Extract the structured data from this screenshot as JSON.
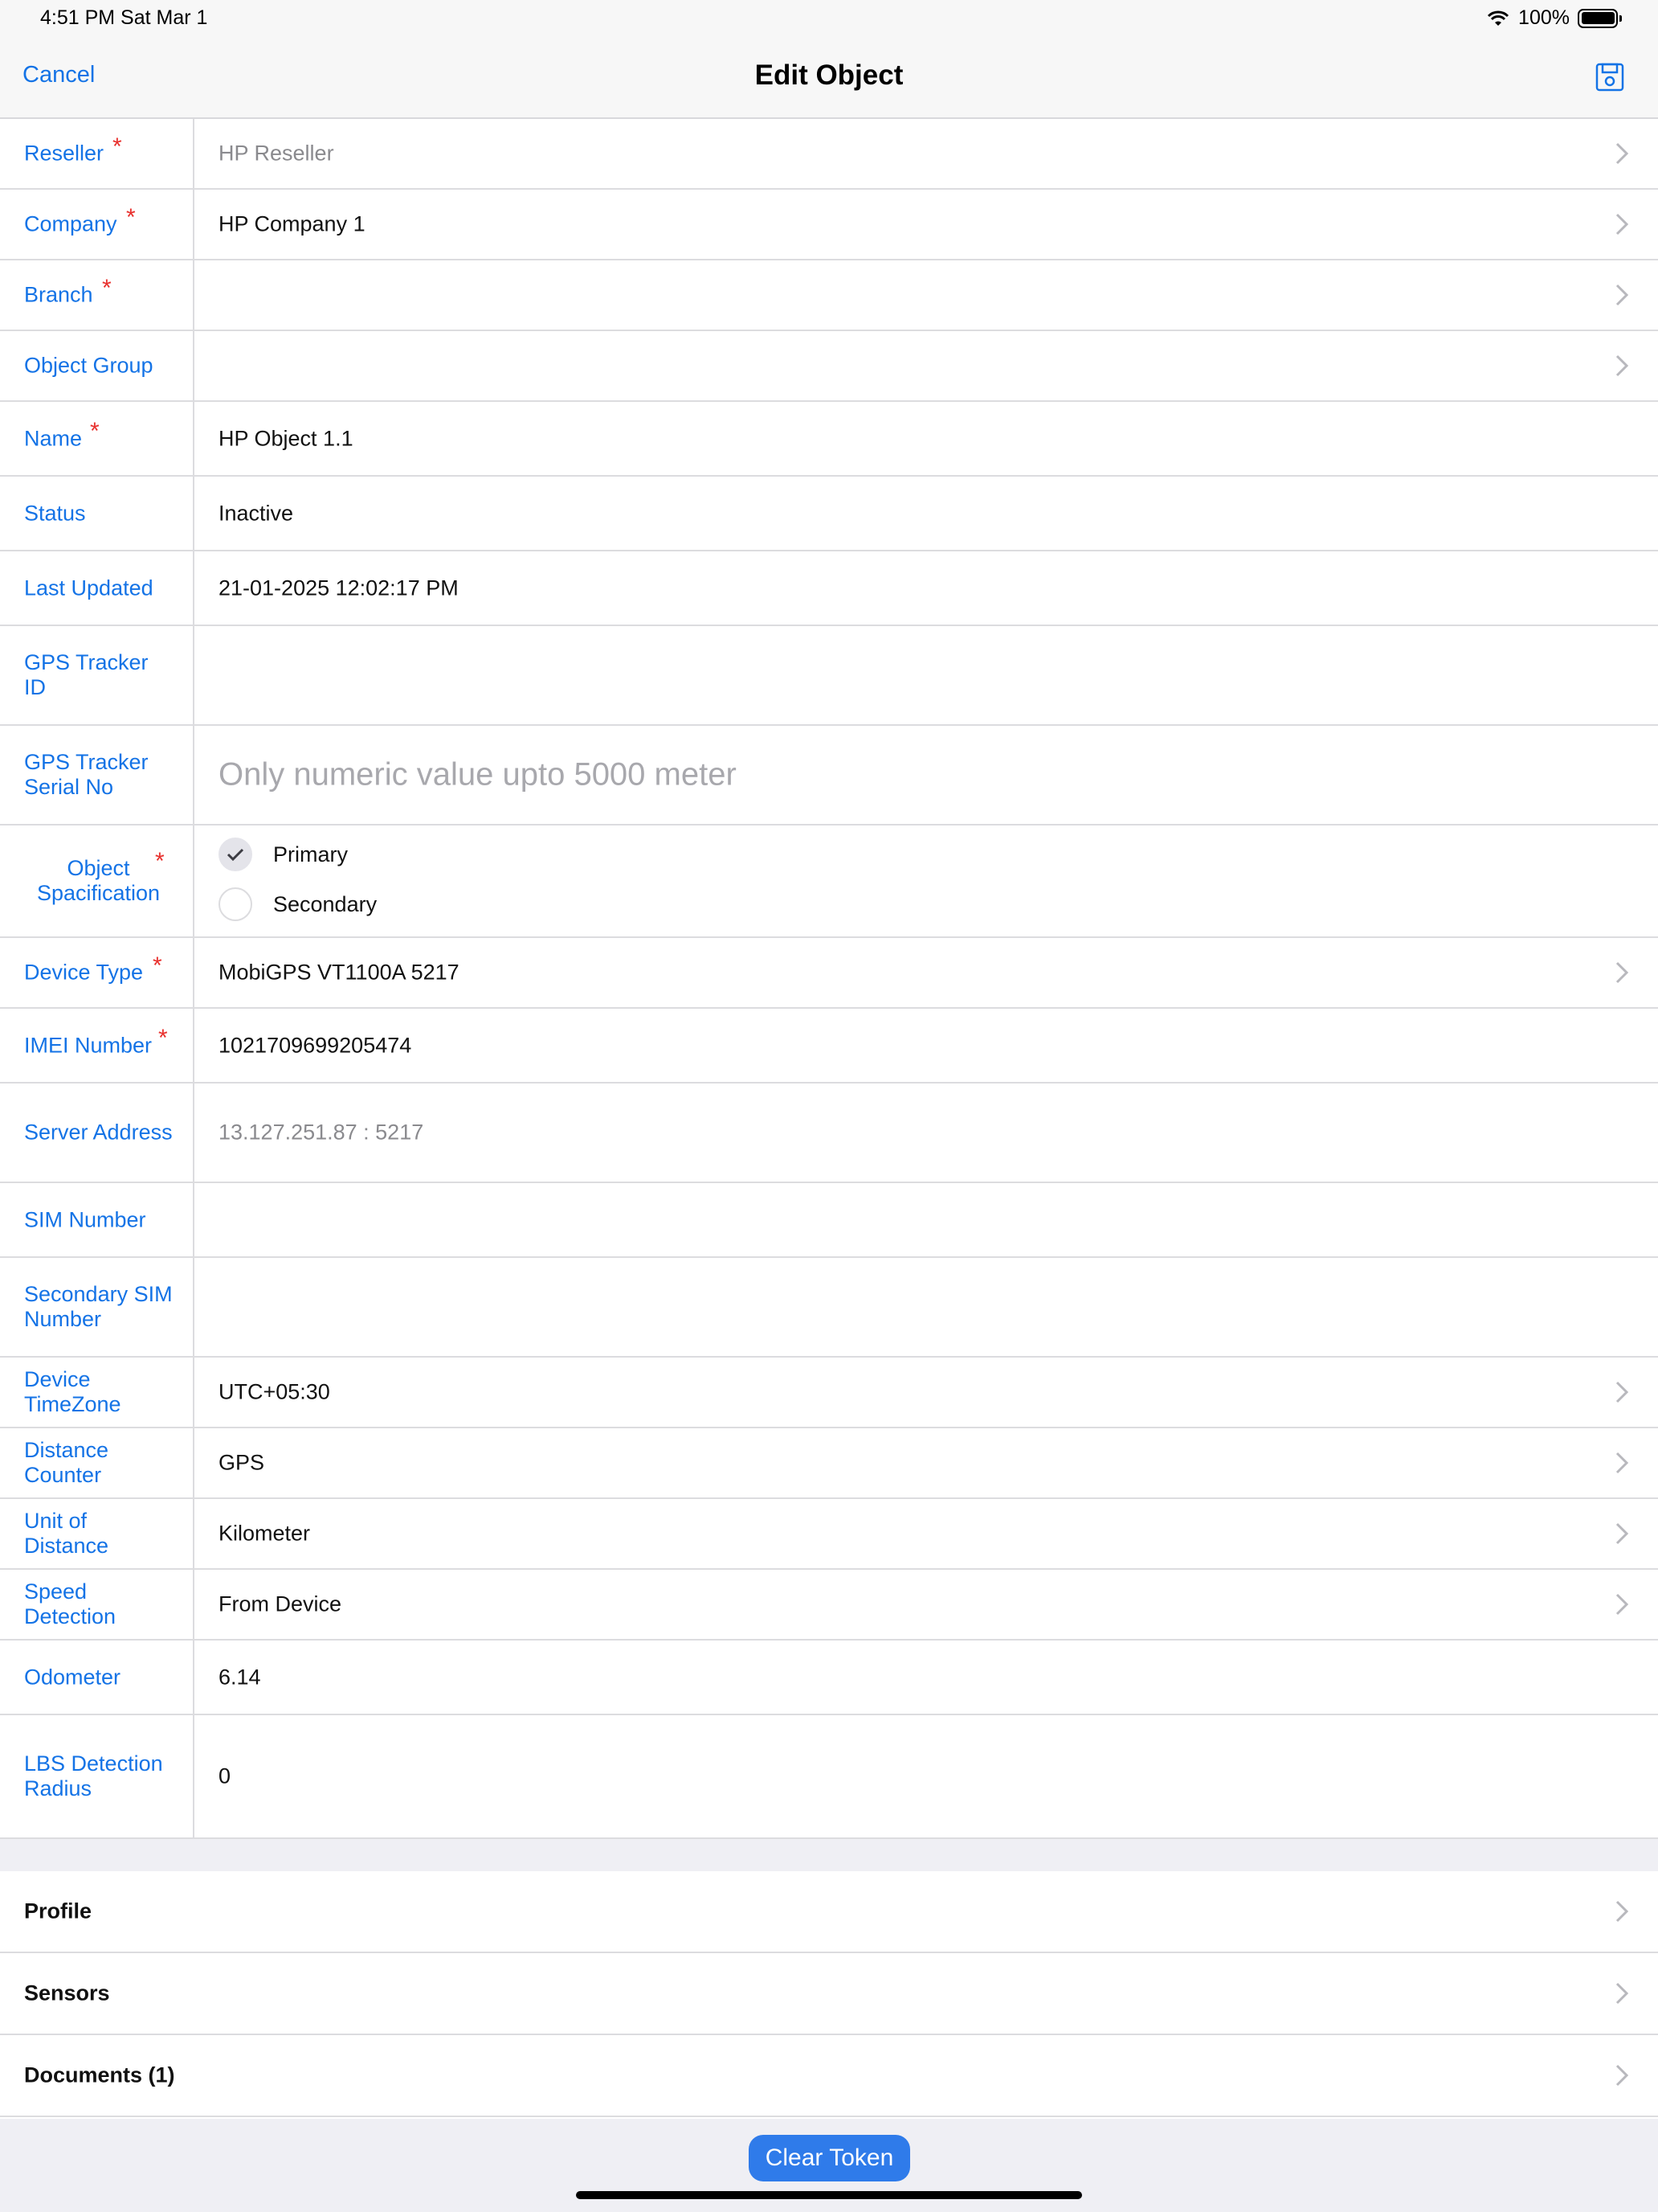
{
  "status_bar": {
    "time": "4:51 PM   Sat Mar 1",
    "battery": "100%"
  },
  "nav": {
    "cancel": "Cancel",
    "title": "Edit Object",
    "save_icon": "floppy-disk-icon"
  },
  "fields": {
    "reseller": {
      "label": "Reseller",
      "value": "HP Reseller"
    },
    "company": {
      "label": "Company",
      "value": "HP Company 1"
    },
    "branch": {
      "label": "Branch",
      "value": ""
    },
    "object_group": {
      "label": "Object Group",
      "value": ""
    },
    "name": {
      "label": "Name",
      "value": "HP Object 1.1"
    },
    "status": {
      "label": "Status",
      "value": "Inactive"
    },
    "last_updated": {
      "label": "Last Updated",
      "value": "21-01-2025 12:02:17 PM"
    },
    "gps_tracker_id": {
      "label": "GPS Tracker ID",
      "value": ""
    },
    "gps_tracker_serial": {
      "label": "GPS Tracker Serial No",
      "placeholder": "Only numeric value upto 5000 meter"
    },
    "object_spec": {
      "label": "Object Spacification",
      "options": [
        "Primary",
        "Secondary"
      ],
      "selected": "Primary"
    },
    "device_type": {
      "label": "Device Type",
      "value": "MobiGPS VT1100A 5217"
    },
    "imei": {
      "label": "IMEI Number",
      "value": "1021709699205474"
    },
    "server_address": {
      "label": "Server Address",
      "value": "13.127.251.87 : 5217"
    },
    "sim_number": {
      "label": "SIM Number",
      "value": ""
    },
    "secondary_sim": {
      "label": "Secondary SIM Number",
      "value": ""
    },
    "device_timezone": {
      "label": "Device TimeZone",
      "value": "UTC+05:30"
    },
    "distance_counter": {
      "label": "Distance Counter",
      "value": "GPS"
    },
    "unit_of_distance": {
      "label": "Unit of Distance",
      "value": "Kilometer"
    },
    "speed_detection": {
      "label": "Speed Detection",
      "value": "From Device"
    },
    "odometer": {
      "label": "Odometer",
      "value": "6.14"
    },
    "lbs_radius": {
      "label": "LBS Detection Radius",
      "value": "0"
    }
  },
  "menu": {
    "profile": "Profile",
    "sensors": "Sensors",
    "documents": "Documents (1)"
  },
  "footer": {
    "clear_token": "Clear Token"
  },
  "colors": {
    "accent": "#1473e6",
    "required": "#e8302d",
    "button": "#2f7bea"
  }
}
